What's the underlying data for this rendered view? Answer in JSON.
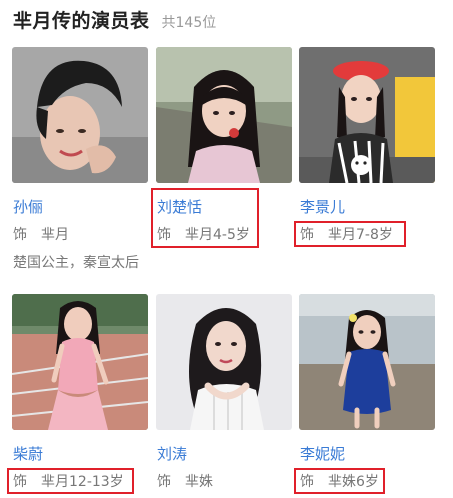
{
  "page": {
    "title": "芈月传的演员表",
    "count": "共145位"
  },
  "actors": [
    {
      "name": "孙俪",
      "role_prefix": "饰",
      "role": "芈月",
      "extra": "楚国公主，秦宣太后"
    },
    {
      "name": "刘楚恬",
      "role_prefix": "饰",
      "role": "芈月4-5岁"
    },
    {
      "name": "李景儿",
      "role_prefix": "饰",
      "role": "芈月7-8岁"
    },
    {
      "name": "柴蔚",
      "role_prefix": "饰",
      "role": "芈月12-13岁"
    },
    {
      "name": "刘涛",
      "role_prefix": "饰",
      "role": "芈姝"
    },
    {
      "name": "李妮妮",
      "role_prefix": "饰",
      "role": "芈姝6岁"
    }
  ],
  "colors": {
    "link": "#3a7bd5",
    "highlight": "#e0202a"
  }
}
